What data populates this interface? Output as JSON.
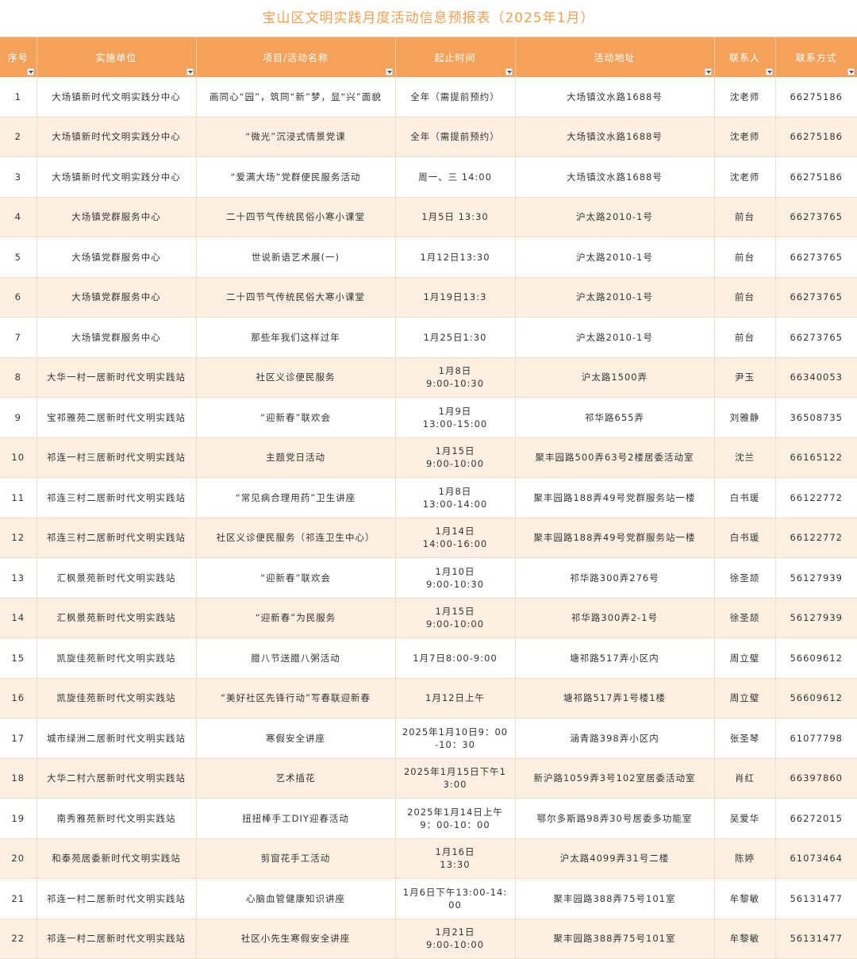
{
  "title": "宝山区文明实践月度活动信息预报表（2025年1月）",
  "headers": [
    "序号",
    "实施单位",
    "项目/活动名称",
    "起止时间",
    "活动地址",
    "联系人",
    "联系方式"
  ],
  "rows": [
    [
      "1",
      "大场镇新时代文明实践分中心",
      "画同心“园”，筑同“新”梦，显“兴”面貌",
      "全年（需提前预约）",
      "大场镇汶水路1688号",
      "沈老师",
      "66275186"
    ],
    [
      "2",
      "大场镇新时代文明实践分中心",
      "“微光”沉浸式情景党课",
      "全年（需提前预约）",
      "大场镇汶水路1688号",
      "沈老师",
      "66275186"
    ],
    [
      "3",
      "大场镇新时代文明实践分中心",
      "“爱满大场”党群便民服务活动",
      "周一、三 14:00",
      "大场镇汶水路1688号",
      "沈老师",
      "66275186"
    ],
    [
      "4",
      "大场镇党群服务中心",
      "二十四节气传统民俗小寒小课堂",
      "1月5日 13:30",
      "沪太路2010-1号",
      "前台",
      "66273765"
    ],
    [
      "5",
      "大场镇党群服务中心",
      "世说新语艺术展(一)",
      "1月12日13:30",
      "沪太路2010-1号",
      "前台",
      "66273765"
    ],
    [
      "6",
      "大场镇党群服务中心",
      "二十四节气传统民俗大寒小课堂",
      "1月19日13:3",
      "沪太路2010-1号",
      "前台",
      "66273765"
    ],
    [
      "7",
      "大场镇党群服务中心",
      "那些年我们这样过年",
      "1月25日1:30",
      "沪太路2010-1号",
      "前台",
      "66273765"
    ],
    [
      "8",
      "大华一村一居新时代文明实践站",
      "社区义诊便民服务",
      "1月8日\n9:00-10:30",
      "沪太路1500弄",
      "尹玉",
      "66340053"
    ],
    [
      "9",
      "宝祁雅苑二居新时代文明实践站",
      "“迎新春”联欢会",
      "1月9日\n13:00-15:00",
      "祁华路655弄",
      "刘雅静",
      "36508735"
    ],
    [
      "10",
      "祁连一村三居新时代文明实践站",
      "主题党日活动",
      "1月15日\n9:00-10:00",
      "聚丰园路500弄63号2楼居委活动室",
      "沈兰",
      "66165122"
    ],
    [
      "11",
      "祁连三村二居新时代文明实践站",
      "“常见病合理用药”卫生讲座",
      "1月8日\n13:00-14:00",
      "聚丰园路188弄49号党群服务站一楼",
      "白书瑗",
      "66122772"
    ],
    [
      "12",
      "祁连三村二居新时代文明实践站",
      "社区义诊便民服务（祁连卫生中心）",
      "1月14日\n14:00-16:00",
      "聚丰园路188弄49号党群服务站一楼",
      "白书瑗",
      "66122772"
    ],
    [
      "13",
      "汇枫景苑新时代文明实践站",
      "“迎新春”联欢会",
      "1月10日\n9:00-10:30",
      "祁华路300弄276号",
      "徐圣颉",
      "56127939"
    ],
    [
      "14",
      "汇枫景苑新时代文明实践站",
      "“迎新春”为民服务",
      "1月15日\n9:00-10:00",
      "祁华路300弄2-1号",
      "徐圣颉",
      "56127939"
    ],
    [
      "15",
      "凯旋佳苑新时代文明实践站",
      "腊八节送腊八粥活动",
      "1月7日8:00-9:00",
      "塘祁路517弄小区内",
      "周立璧",
      "56609612"
    ],
    [
      "16",
      "凯旋佳苑新时代文明实践站",
      "“美好社区先锋行动”写春联迎新春",
      "1月12日上午",
      "塘祁路517弄1号楼1楼",
      "周立璧",
      "56609612"
    ],
    [
      "17",
      "城市绿洲二居新时代文明实践站",
      "寒假安全讲座",
      "2025年1月10日9：00-10：30",
      "涵青路398弄小区内",
      "张圣琴",
      "61077798"
    ],
    [
      "18",
      "大华二村六居新时代文明实践站",
      "艺术插花",
      "2025年1月15日下午13:00",
      "新沪路1059弄3号102室居委活动室",
      "肖红",
      "66397860"
    ],
    [
      "19",
      "南秀雅苑新时代文明实践站",
      "扭扭棒手工DIY迎春活动",
      "2025年1月14日上午9：00-10：00",
      "鄂尔多斯路98弄30号居委多功能室",
      "吴爱华",
      "66272015"
    ],
    [
      "20",
      "和泰苑居委新时代文明实践站",
      "剪窗花手工活动",
      "1月16日\n13:30",
      "沪太路4099弄31号二楼",
      "陈婷",
      "61073464"
    ],
    [
      "21",
      "祁连一村二居新时代文明实践站",
      "心脑血管健康知识讲座",
      "1月6日下午13:00-14:00",
      "聚丰园路388弄75号101室",
      "牟黎敏",
      "56131477"
    ],
    [
      "22",
      "祁连一村二居新时代文明实践站",
      "社区小先生寒假安全讲座",
      "1月21日\n9:00-10:00",
      "聚丰园路388弄75号101室",
      "牟黎敏",
      "56131477"
    ]
  ]
}
